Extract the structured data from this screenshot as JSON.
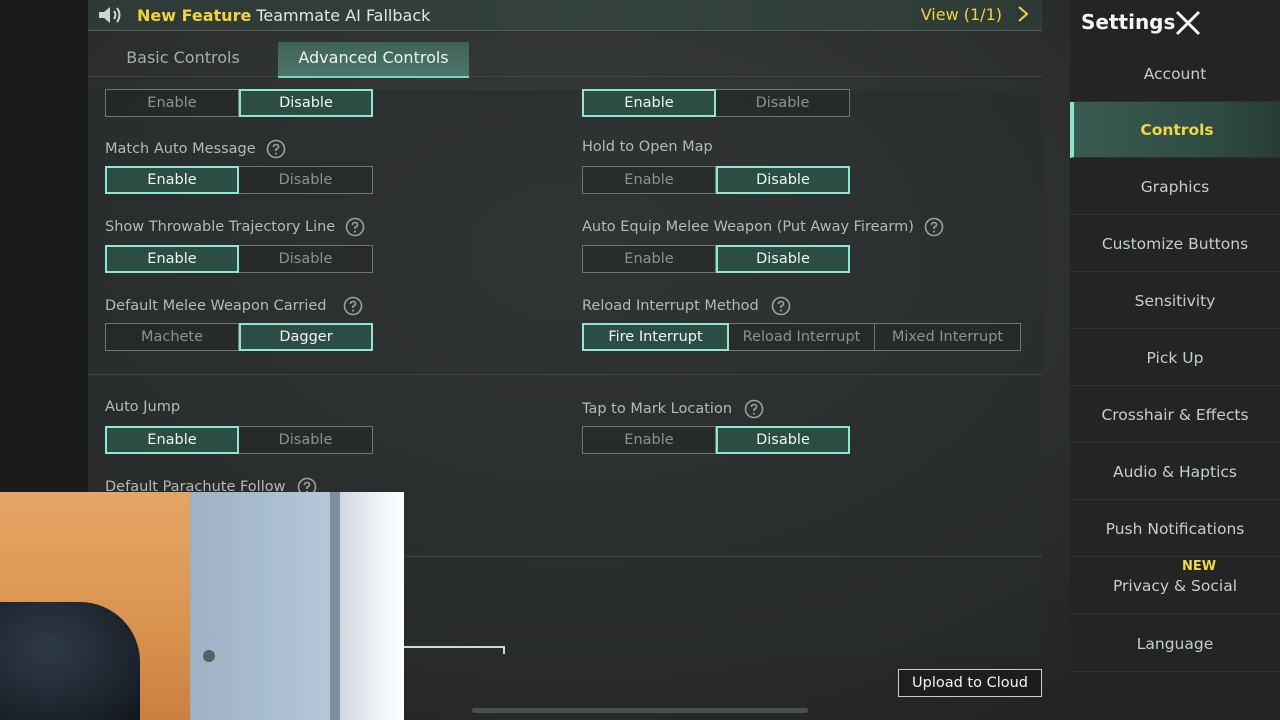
{
  "banner": {
    "new_label": "New Feature",
    "text": "Teammate AI Fallback",
    "view_label": "View (1/1)",
    "icon": "speaker-icon"
  },
  "tabs": [
    {
      "label": "Basic Controls",
      "active": false
    },
    {
      "label": "Advanced Controls",
      "active": true
    }
  ],
  "settings": {
    "top_left": {
      "options": [
        "Enable",
        "Disable"
      ],
      "selected": "Disable"
    },
    "top_right": {
      "options": [
        "Enable",
        "Disable"
      ],
      "selected": "Enable"
    },
    "match_auto_message": {
      "label": "Match Auto Message",
      "options": [
        "Enable",
        "Disable"
      ],
      "selected": "Enable"
    },
    "hold_to_open_map": {
      "label": "Hold to Open Map",
      "options": [
        "Enable",
        "Disable"
      ],
      "selected": "Disable"
    },
    "show_throwable_trajectory": {
      "label": "Show Throwable Trajectory Line",
      "options": [
        "Enable",
        "Disable"
      ],
      "selected": "Enable"
    },
    "auto_equip_melee": {
      "label": "Auto Equip Melee Weapon (Put Away Firearm)",
      "options": [
        "Enable",
        "Disable"
      ],
      "selected": "Disable"
    },
    "default_melee_weapon": {
      "label": "Default Melee Weapon Carried",
      "options": [
        "Machete",
        "Dagger"
      ],
      "selected": "Dagger"
    },
    "reload_interrupt_method": {
      "label": "Reload Interrupt Method",
      "options": [
        "Fire Interrupt",
        "Reload Interrupt",
        "Mixed Interrupt"
      ],
      "selected": "Fire Interrupt"
    },
    "auto_jump": {
      "label": "Auto Jump",
      "options": [
        "Enable",
        "Disable"
      ],
      "selected": "Enable"
    },
    "tap_to_mark_location": {
      "label": "Tap to Mark Location",
      "options": [
        "Enable",
        "Disable"
      ],
      "selected": "Disable"
    },
    "default_parachute_follow": {
      "label": "Default Parachute Follow"
    }
  },
  "sidebar": {
    "title": "Settings",
    "items": [
      {
        "label": "Account",
        "active": false
      },
      {
        "label": "Controls",
        "active": true
      },
      {
        "label": "Graphics",
        "active": false
      },
      {
        "label": "Customize Buttons",
        "active": false
      },
      {
        "label": "Sensitivity",
        "active": false
      },
      {
        "label": "Pick Up",
        "active": false
      },
      {
        "label": "Crosshair & Effects",
        "active": false
      },
      {
        "label": "Audio & Haptics",
        "active": false
      },
      {
        "label": "Push Notifications",
        "active": false
      },
      {
        "label": "Privacy & Social",
        "active": false,
        "badge": "NEW"
      },
      {
        "label": "Language",
        "active": false
      }
    ]
  },
  "upload_button": "Upload to Cloud",
  "colors": {
    "accent": "#93e4d2",
    "highlight": "#f0d843",
    "selected_bg": "#2c4d44"
  }
}
